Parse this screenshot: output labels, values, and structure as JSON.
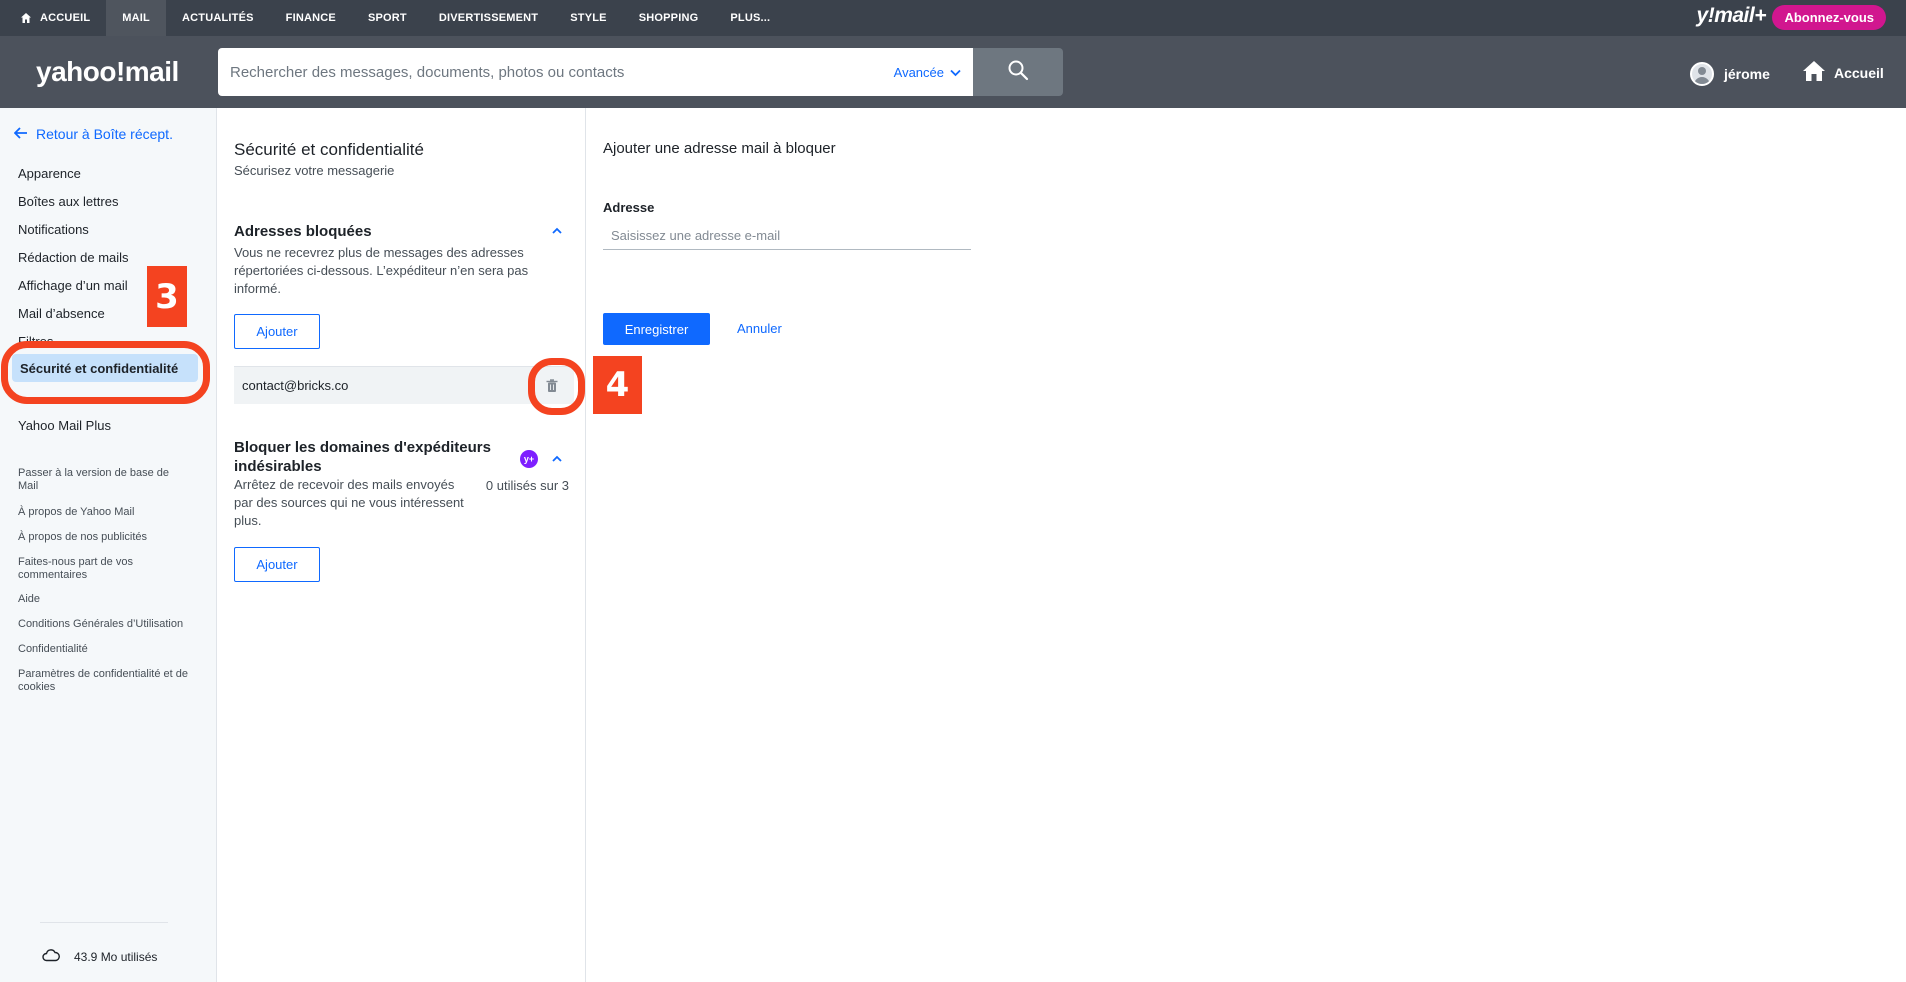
{
  "topnav": {
    "items": [
      "ACCUEIL",
      "MAIL",
      "ACTUALITÉS",
      "FINANCE",
      "SPORT",
      "DIVERTISSEMENT",
      "STYLE",
      "SHOPPING",
      "PLUS..."
    ],
    "brand": "y!mail+",
    "subscribe": "Abonnez-vous"
  },
  "header": {
    "logo": "yahoo!mail",
    "search_placeholder": "Rechercher des messages, documents, photos ou contacts",
    "advanced": "Avancée",
    "user_name": "jérome",
    "home": "Accueil"
  },
  "sidebar": {
    "back": "Retour à Boîte récept.",
    "items": [
      "Apparence",
      "Boîtes aux lettres",
      "Notifications",
      "Rédaction de mails",
      "Affichage d’un mail",
      "Mail d’absence",
      "Filtres"
    ],
    "active": "Sécurité et confidentialité",
    "plus": "Yahoo Mail Plus",
    "footer_links": [
      "Passer à la version de base de Mail",
      "À propos de Yahoo Mail",
      "À propos de nos publicités",
      "Faites-nous part de vos commentaires",
      "Aide",
      "Conditions Générales d’Utilisation",
      "Confidentialité",
      "Paramètres de confidentialité et de cookies"
    ],
    "storage": "43.9 Mo utilisés"
  },
  "middle": {
    "title": "Sécurité et confidentialité",
    "subtitle": "Sécurisez votre messagerie",
    "blocked": {
      "title": "Adresses bloquées",
      "description": "Vous ne recevrez plus de messages des adresses répertoriées ci-dessous. L’expéditeur n’en sera pas informé.",
      "add": "Ajouter",
      "entries": [
        "contact@bricks.co"
      ]
    },
    "domains": {
      "title": "Bloquer les domaines d'expéditeurs indésirables",
      "badge": "y+",
      "description": "Arrêtez de recevoir des mails envoyés par des sources qui ne vous intéressent plus.",
      "usage": "0 utilisés sur 3",
      "add": "Ajouter"
    }
  },
  "right": {
    "title": "Ajouter une adresse mail à bloquer",
    "address_label": "Adresse",
    "address_placeholder": "Saisissez une adresse e-mail",
    "address_value": "",
    "save": "Enregistrer",
    "cancel": "Annuler"
  },
  "annotations": [
    "3",
    "4"
  ],
  "colors": {
    "accent": "#0f69ff",
    "topnav_bg": "#3b424c",
    "header_bg": "#4c525c",
    "subscribe_bg": "#d1168f",
    "sidebar_active_bg": "#c6e1fb",
    "annotation": "#f44320"
  },
  "icons": {
    "home_nav": "home-icon",
    "advanced": "chevron-down-icon",
    "search": "search-icon",
    "avatar": "user-avatar-icon",
    "home_header": "home-icon",
    "back": "arrow-left-icon",
    "collapse": "chevron-up-icon",
    "delete": "trash-icon",
    "storage": "cloud-icon"
  }
}
